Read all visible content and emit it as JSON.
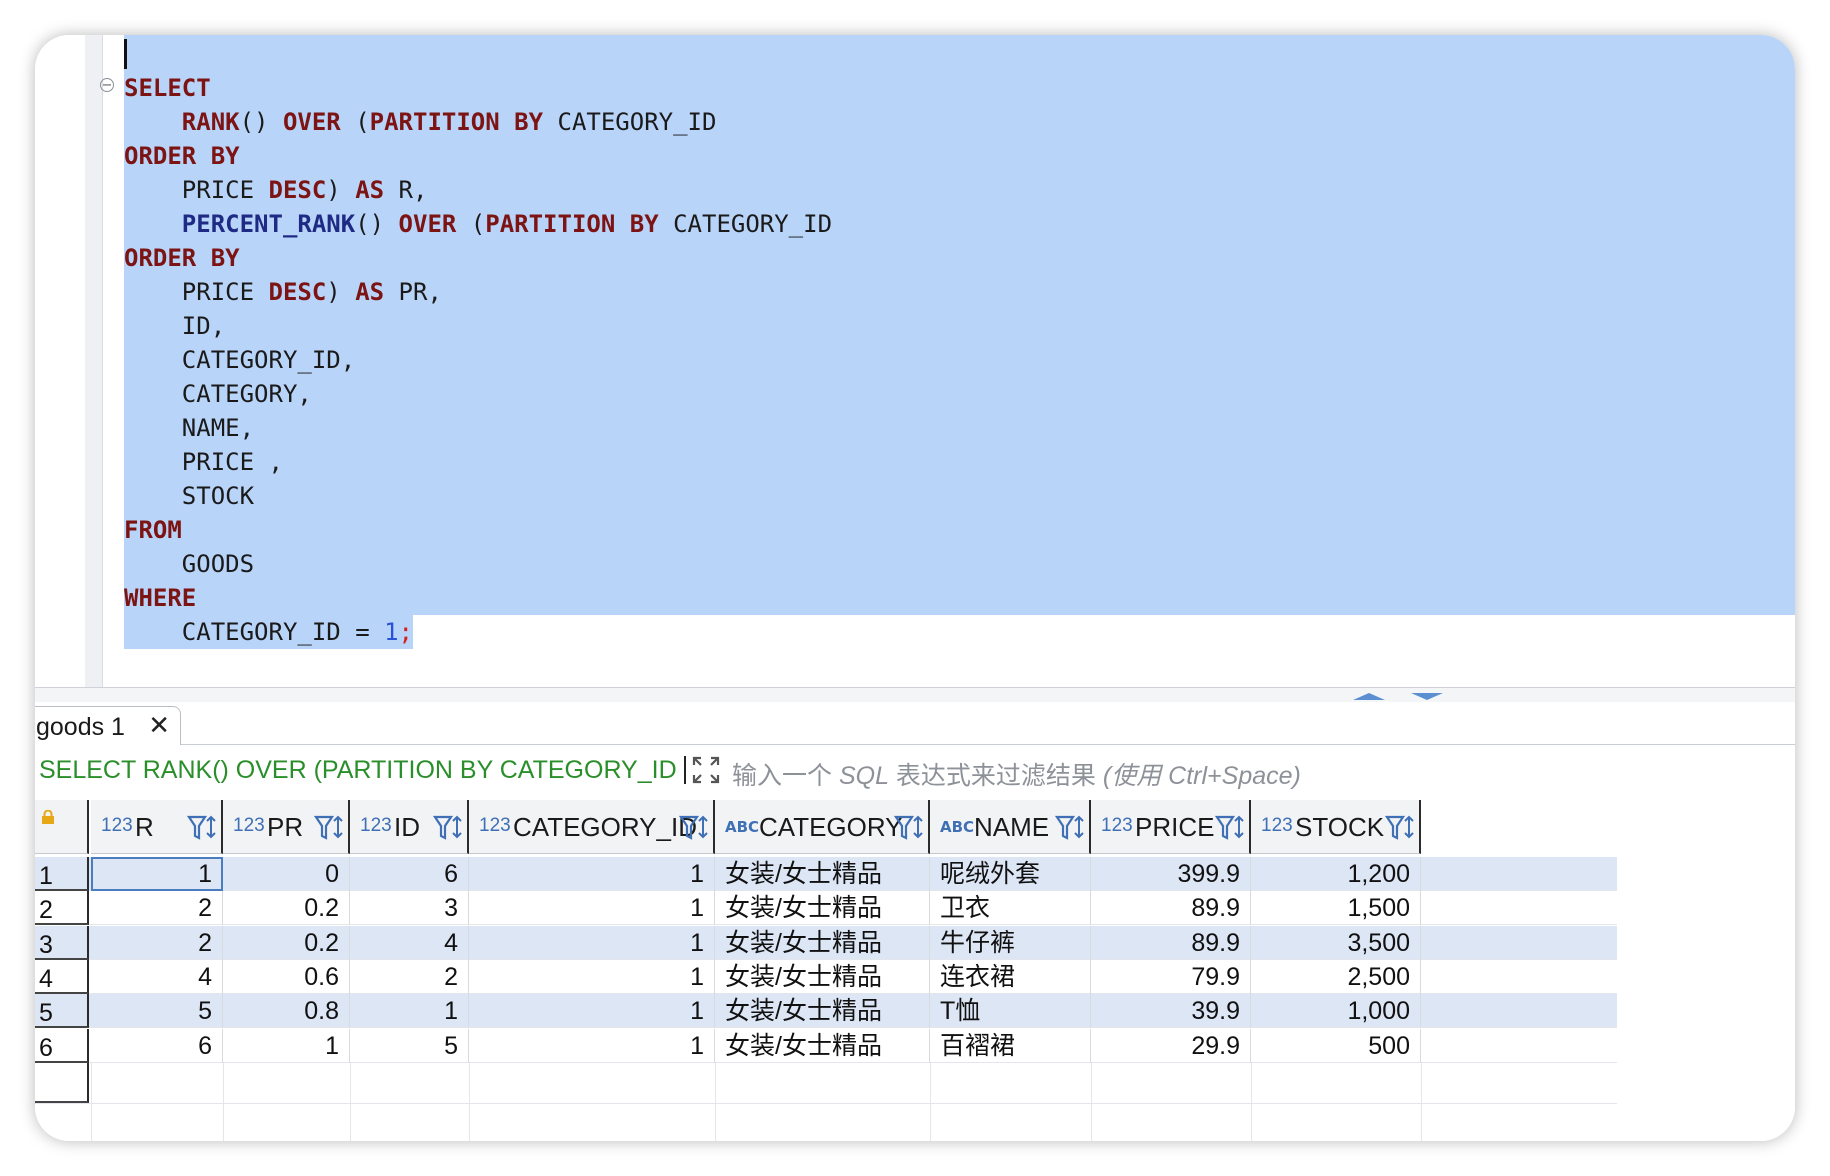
{
  "editor": {
    "lines": [
      [
        {
          "t": "SELECT",
          "c": "k"
        }
      ],
      [
        {
          "t": "    "
        },
        {
          "t": "RANK",
          "c": "k"
        },
        {
          "t": "() ",
          "c": "i"
        },
        {
          "t": "OVER",
          "c": "k"
        },
        {
          "t": " (",
          "c": "i"
        },
        {
          "t": "PARTITION BY",
          "c": "k"
        },
        {
          "t": " CATEGORY_ID",
          "c": "i"
        }
      ],
      [
        {
          "t": "ORDER BY",
          "c": "k"
        }
      ],
      [
        {
          "t": "    PRICE ",
          "c": "i"
        },
        {
          "t": "DESC",
          "c": "k"
        },
        {
          "t": ") ",
          "c": "i"
        },
        {
          "t": "AS",
          "c": "k"
        },
        {
          "t": " R,",
          "c": "i"
        }
      ],
      [
        {
          "t": "    "
        },
        {
          "t": "PERCENT_RANK",
          "c": "f"
        },
        {
          "t": "() ",
          "c": "i"
        },
        {
          "t": "OVER",
          "c": "k"
        },
        {
          "t": " (",
          "c": "i"
        },
        {
          "t": "PARTITION BY",
          "c": "k"
        },
        {
          "t": " CATEGORY_ID",
          "c": "i"
        }
      ],
      [
        {
          "t": "ORDER BY",
          "c": "k"
        }
      ],
      [
        {
          "t": "    PRICE ",
          "c": "i"
        },
        {
          "t": "DESC",
          "c": "k"
        },
        {
          "t": ") ",
          "c": "i"
        },
        {
          "t": "AS",
          "c": "k"
        },
        {
          "t": " PR,",
          "c": "i"
        }
      ],
      [
        {
          "t": "    ID,",
          "c": "i"
        }
      ],
      [
        {
          "t": "    CATEGORY_ID,",
          "c": "i"
        }
      ],
      [
        {
          "t": "    CATEGORY,",
          "c": "i"
        }
      ],
      [
        {
          "t": "    NAME,",
          "c": "i"
        }
      ],
      [
        {
          "t": "    PRICE ,",
          "c": "i"
        }
      ],
      [
        {
          "t": "    STOCK",
          "c": "i"
        }
      ],
      [
        {
          "t": "FROM",
          "c": "k"
        }
      ],
      [
        {
          "t": "    GOODS",
          "c": "i"
        }
      ],
      [
        {
          "t": "WHERE",
          "c": "k"
        }
      ],
      [
        {
          "t": "    CATEGORY_ID = ",
          "c": "i"
        },
        {
          "t": "1",
          "c": "n"
        },
        {
          "t": ";",
          "c": "r"
        }
      ]
    ]
  },
  "results": {
    "tab_label": "goods 1",
    "close_glyph": "✕",
    "query_text": "SELECT RANK() OVER (PARTITION BY CATEGORY_ID",
    "filter_placeholder_prefix": "输入一个 ",
    "filter_placeholder_sql": "SQL",
    "filter_placeholder_mid": " 表达式来过滤结果 ",
    "filter_placeholder_hint": "(使用 Ctrl+Space)",
    "columns": [
      {
        "type": "123",
        "name": "R",
        "align": "num"
      },
      {
        "type": "123",
        "name": "PR",
        "align": "num"
      },
      {
        "type": "123",
        "name": "ID",
        "align": "num"
      },
      {
        "type": "123",
        "name": "CATEGORY_ID",
        "align": "num"
      },
      {
        "type": "ABC",
        "name": "CATEGORY",
        "align": "txt"
      },
      {
        "type": "ABC",
        "name": "NAME",
        "align": "txt"
      },
      {
        "type": "123",
        "name": "PRICE",
        "align": "num"
      },
      {
        "type": "123",
        "name": "STOCK",
        "align": "num"
      }
    ],
    "rows": [
      {
        "num": "1",
        "cells": [
          "1",
          "0",
          "6",
          "1",
          "女装/女士精品",
          "呢绒外套",
          "399.9",
          "1,200"
        ]
      },
      {
        "num": "2",
        "cells": [
          "2",
          "0.2",
          "3",
          "1",
          "女装/女士精品",
          "卫衣",
          "89.9",
          "1,500"
        ]
      },
      {
        "num": "3",
        "cells": [
          "2",
          "0.2",
          "4",
          "1",
          "女装/女士精品",
          "牛仔裤",
          "89.9",
          "3,500"
        ]
      },
      {
        "num": "4",
        "cells": [
          "4",
          "0.6",
          "2",
          "1",
          "女装/女士精品",
          "连衣裙",
          "79.9",
          "2,500"
        ]
      },
      {
        "num": "5",
        "cells": [
          "5",
          "0.8",
          "1",
          "1",
          "女装/女士精品",
          "T恤",
          "39.9",
          "1,000"
        ]
      },
      {
        "num": "6",
        "cells": [
          "6",
          "1",
          "5",
          "1",
          "女装/女士精品",
          "百褶裙",
          "29.9",
          "500"
        ]
      }
    ]
  },
  "colors": {
    "selection": "#b9d4f9",
    "row_stripe": "#dde6f5",
    "keyword": "#7d1414",
    "function": "#1f2a85",
    "query_green": "#2a8f2a"
  }
}
